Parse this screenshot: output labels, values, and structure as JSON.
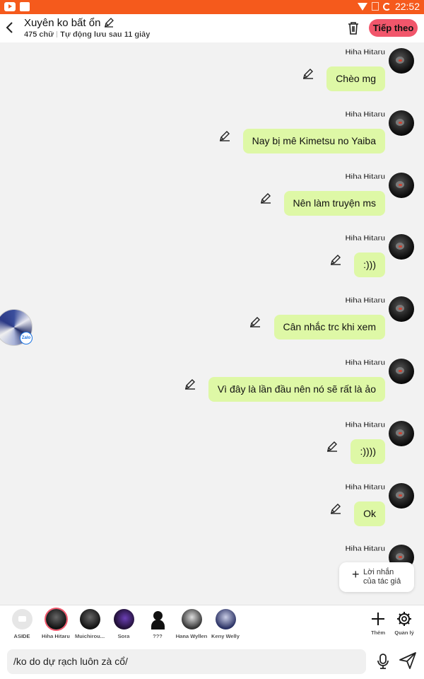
{
  "status_bar": {
    "time": "22:52",
    "icons": [
      "youtube-icon",
      "app-icon",
      "wifi-icon",
      "no-sim-icon",
      "battery-charging-icon"
    ]
  },
  "header": {
    "title": "Xuyên ko bất ổn",
    "word_count": "475 chữ",
    "autosave": "Tự động lưu sau 11 giây",
    "next_label": "Tiếp theo",
    "accent": "#f1566b",
    "status_color": "#f55a1c"
  },
  "messages": [
    {
      "sender": "Hiha Hitaru",
      "text": "Chèo mg"
    },
    {
      "sender": "Hiha Hitaru",
      "text": "Nay bị mê Kimetsu no Yaiba"
    },
    {
      "sender": "Hiha Hitaru",
      "text": "Nên làm truyện ms"
    },
    {
      "sender": "Hiha Hitaru",
      "text": ":)))"
    },
    {
      "sender": "Hiha Hitaru",
      "text": "Cân nhắc trc khi xem"
    },
    {
      "sender": "Hiha Hitaru",
      "text": "Vì đây là lần đầu nên nó sẽ rất là ảo"
    },
    {
      "sender": "Hiha Hitaru",
      "text": ":))))"
    },
    {
      "sender": "Hiha Hitaru",
      "text": "Ok"
    },
    {
      "sender": "Hiha Hitaru",
      "text": ""
    }
  ],
  "bubble_color": "#def8a6",
  "floating_badge": "Zalo",
  "note_button": {
    "line1": "Lời nhắn",
    "line2": "của tác giả"
  },
  "characters": [
    {
      "name": "ASIDE"
    },
    {
      "name": "Hiha Hitaru"
    },
    {
      "name": "Muichirou..."
    },
    {
      "name": "Sora"
    },
    {
      "name": "???"
    },
    {
      "name": "Hana Wyllen"
    },
    {
      "name": "Keny Welly"
    }
  ],
  "tools": {
    "add_label": "Thêm",
    "manage_label": "Quản lý"
  },
  "composer": {
    "value": "/ko do dự rạch luôn zà cổ/"
  }
}
